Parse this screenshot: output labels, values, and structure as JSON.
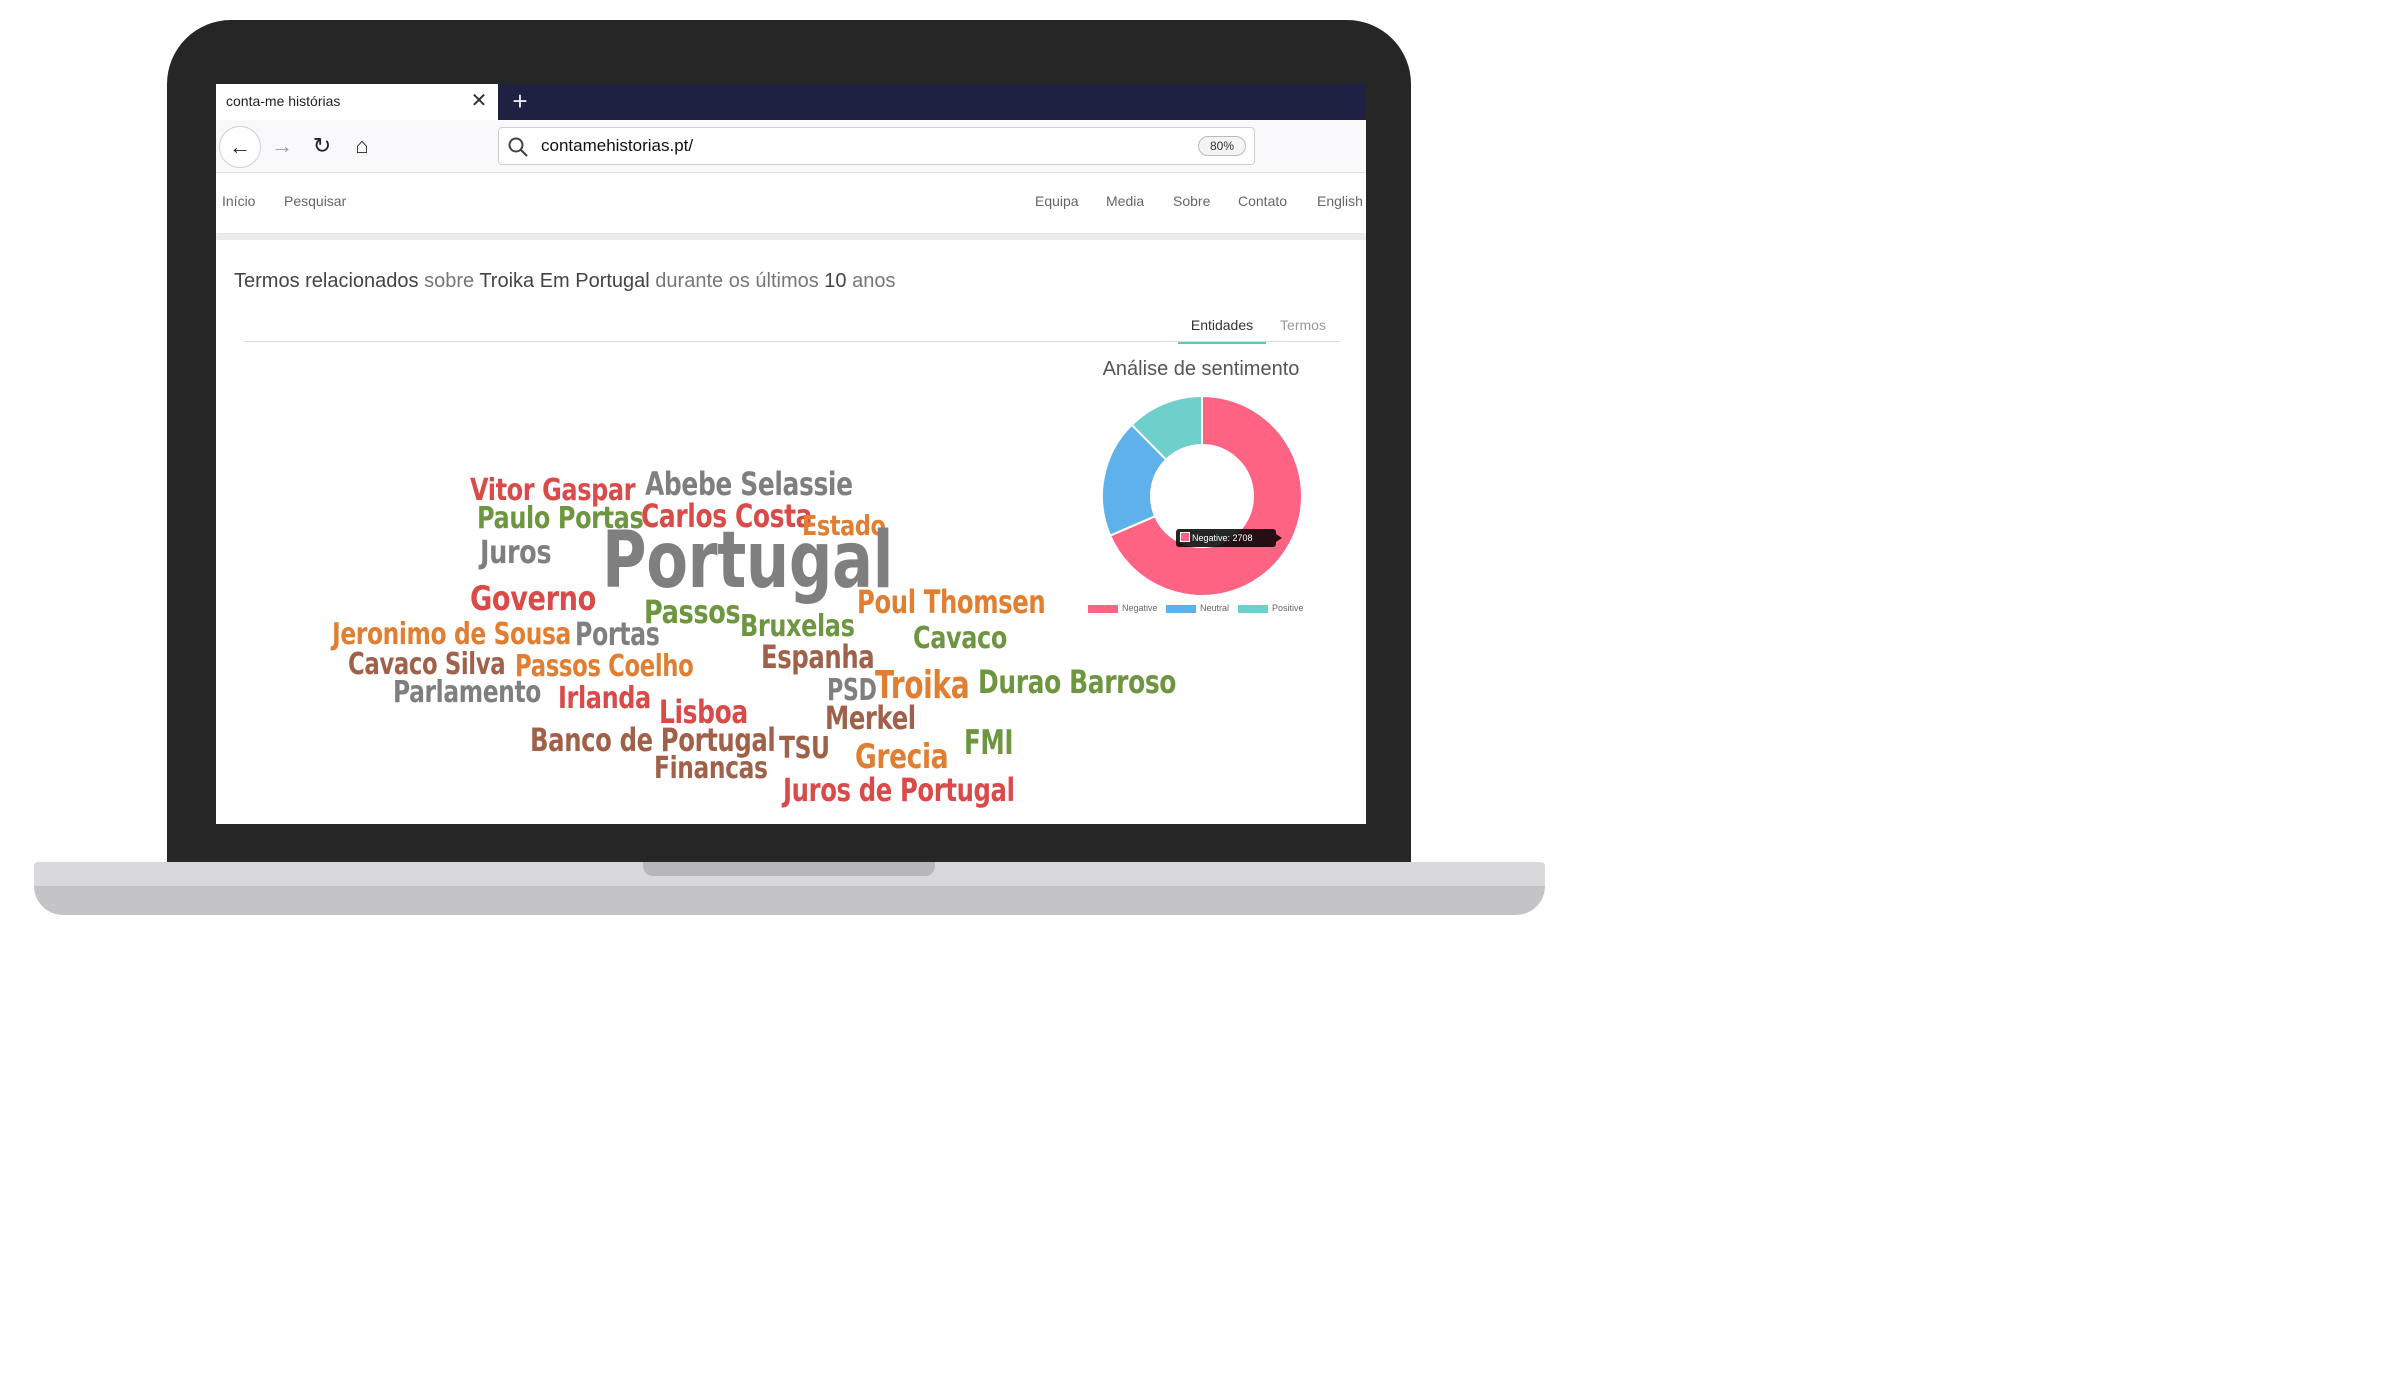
{
  "browser": {
    "tab_title": "conta-me histórias",
    "tab_close": "✕",
    "new_tab": "+",
    "back": "←",
    "forward": "→",
    "reload": "↻",
    "home": "⌂",
    "url": "contamehistorias.pt/",
    "zoom": "80%"
  },
  "site_nav": {
    "left": [
      "Início",
      "Pesquisar"
    ],
    "right": [
      "Equipa",
      "Media",
      "Sobre",
      "Contato",
      "English"
    ]
  },
  "heading": {
    "p1": "Termos relacionados",
    "p2": " sobre ",
    "topic": "Troika Em Portugal",
    "p3": " durante os últimos ",
    "years": "10",
    "p4": " anos"
  },
  "tabs": {
    "active": "Entidades",
    "inactive": "Termos"
  },
  "chart_data": {
    "type": "pie",
    "title": "Análise de sentimento",
    "labels": [
      "Negative",
      "Neutral",
      "Positive"
    ],
    "values": [
      2708,
      754,
      490
    ],
    "colors": [
      "#ff6384",
      "#5fb1ec",
      "#6fcfcb"
    ],
    "tooltip": "Negative: 2708",
    "legend_position": "bottom"
  },
  "word_cloud": [
    {
      "text": "Vitor Gaspar",
      "color": "#d94a48"
    },
    {
      "text": "Abebe Selassie",
      "color": "#7f7f7f"
    },
    {
      "text": "Paulo Portas",
      "color": "#6e9540"
    },
    {
      "text": "Carlos Costa",
      "color": "#d94a48"
    },
    {
      "text": "Estado",
      "color": "#e07f32"
    },
    {
      "text": "Juros",
      "color": "#7f7f7f"
    },
    {
      "text": "Portugal",
      "color": "#7f7f7f"
    },
    {
      "text": "Governo",
      "color": "#d94a48"
    },
    {
      "text": "Poul Thomsen",
      "color": "#e07f32"
    },
    {
      "text": "Passos",
      "color": "#6e9540"
    },
    {
      "text": "Jeronimo de Sousa",
      "color": "#e07f32"
    },
    {
      "text": "Portas",
      "color": "#7f7f7f"
    },
    {
      "text": "Bruxelas",
      "color": "#6e9540"
    },
    {
      "text": "Cavaco",
      "color": "#6e9540"
    },
    {
      "text": "Cavaco Silva",
      "color": "#a0614a"
    },
    {
      "text": "Passos Coelho",
      "color": "#e07f32"
    },
    {
      "text": "Espanha",
      "color": "#a0614a"
    },
    {
      "text": "Parlamento",
      "color": "#7f7f7f"
    },
    {
      "text": "Irlanda",
      "color": "#d94a48"
    },
    {
      "text": "PSD",
      "color": "#7f7f7f"
    },
    {
      "text": "Troika",
      "color": "#e07f32"
    },
    {
      "text": "Durao Barroso",
      "color": "#6e9540"
    },
    {
      "text": "Lisboa",
      "color": "#d94a48"
    },
    {
      "text": "Merkel",
      "color": "#a0614a"
    },
    {
      "text": "Banco de Portugal",
      "color": "#a0614a"
    },
    {
      "text": "TSU",
      "color": "#a0614a"
    },
    {
      "text": "Grecia",
      "color": "#e07f32"
    },
    {
      "text": "FMI",
      "color": "#6e9540"
    },
    {
      "text": "Financas",
      "color": "#a0614a"
    },
    {
      "text": "Juros de Portugal",
      "color": "#d94a48"
    }
  ]
}
